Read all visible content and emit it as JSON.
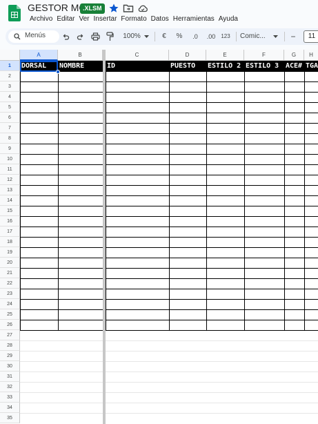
{
  "app": {
    "doc_title": "GESTOR MG",
    "file_badge": ".XLSM",
    "icons": [
      "sheets-logo-icon",
      "star-icon",
      "move-folder-icon",
      "cloud-status-icon"
    ]
  },
  "menu": [
    "Archivo",
    "Editar",
    "Ver",
    "Insertar",
    "Formato",
    "Datos",
    "Herramientas",
    "Ayuda"
  ],
  "toolbar": {
    "search_label": "Menús",
    "zoom": "100%",
    "currency": "€",
    "percent": "%",
    "dec_decrease": ".0",
    "dec_increase": ".00",
    "number_format": "123",
    "font_name": "Comic...",
    "font_size": "11",
    "minus": "−"
  },
  "columns": [
    "A",
    "B",
    "C",
    "D",
    "E",
    "F",
    "G",
    "H"
  ],
  "header_row": [
    "DORSAL",
    "NOMBRE",
    "ID",
    "PUESTO",
    "ESTILO 2",
    "ESTILO 3",
    "ACE#",
    "TGA"
  ],
  "rows": [
    "1",
    "2",
    "3",
    "4",
    "5",
    "6",
    "7",
    "8",
    "9",
    "10",
    "11",
    "12",
    "13",
    "14",
    "15",
    "16",
    "17",
    "18",
    "19",
    "20",
    "21",
    "22",
    "23",
    "24",
    "25",
    "26",
    "27",
    "28",
    "29",
    "30",
    "31",
    "32",
    "33",
    "34",
    "35"
  ],
  "selected_cell": "A1",
  "bordered_rows": 26,
  "colors": {
    "header_fill": "#000000",
    "header_text": "#ffffff",
    "selection": "#0b57d0",
    "badge": "#188038"
  }
}
